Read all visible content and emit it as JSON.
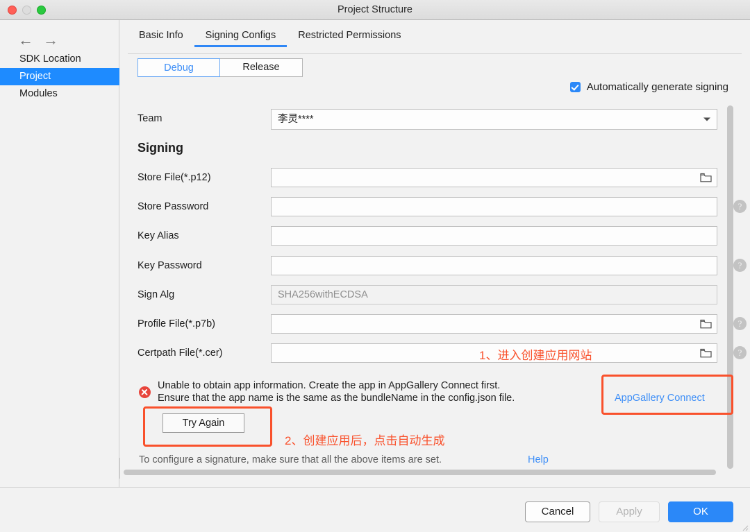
{
  "window": {
    "title": "Project Structure",
    "traffic_lights": [
      "close-button",
      "minimize-button",
      "maximize-button"
    ]
  },
  "sidebar": {
    "nav": {
      "back_icon": "arrow-left-icon",
      "forward_icon": "arrow-right-icon"
    },
    "items": [
      {
        "label": "SDK Location",
        "selected": false
      },
      {
        "label": "Project",
        "selected": true
      },
      {
        "label": "Modules",
        "selected": false
      }
    ]
  },
  "tabs": [
    {
      "label": "Basic Info",
      "active": false
    },
    {
      "label": "Signing Configs",
      "active": true
    },
    {
      "label": "Restricted Permissions",
      "active": false
    }
  ],
  "segmented": {
    "options": [
      {
        "label": "Debug",
        "active": true
      },
      {
        "label": "Release",
        "active": false
      }
    ]
  },
  "auto_signing": {
    "label": "Automatically generate signing",
    "checked": true
  },
  "team": {
    "label": "Team",
    "value": "李灵****"
  },
  "section_title": "Signing",
  "fields": [
    {
      "label": "Store File(*.p12)",
      "value": "",
      "placeholder": "",
      "has_folder": true,
      "has_help": false,
      "readonly": false
    },
    {
      "label": "Store Password",
      "value": "",
      "placeholder": "",
      "has_folder": false,
      "has_help": true,
      "readonly": false
    },
    {
      "label": "Key Alias",
      "value": "",
      "placeholder": "",
      "has_folder": false,
      "has_help": false,
      "readonly": false
    },
    {
      "label": "Key Password",
      "value": "",
      "placeholder": "",
      "has_folder": false,
      "has_help": true,
      "readonly": false
    },
    {
      "label": "Sign Alg",
      "value": "SHA256withECDSA",
      "placeholder": "",
      "has_folder": false,
      "has_help": false,
      "readonly": true
    },
    {
      "label": "Profile File(*.p7b)",
      "value": "",
      "placeholder": "",
      "has_folder": true,
      "has_help": true,
      "readonly": false
    },
    {
      "label": "Certpath File(*.cer)",
      "value": "",
      "placeholder": "",
      "has_folder": true,
      "has_help": true,
      "readonly": false
    }
  ],
  "error": {
    "line1": "Unable to obtain app information. Create the app in AppGallery Connect first.",
    "line2": "Ensure that the app name is the same as the bundleName in the config.json file.",
    "link_label": "AppGallery Connect",
    "retry_label": "Try Again"
  },
  "footer": {
    "note": "To configure a signature, make sure that all the above items are set.",
    "help_label": "Help"
  },
  "dialog_buttons": {
    "cancel": "Cancel",
    "apply": "Apply",
    "ok": "OK"
  },
  "annotations": [
    {
      "id": "step-1",
      "text": "1、进入创建应用网站"
    },
    {
      "id": "step-2",
      "text": "2、创建应用后，点击自动生成"
    }
  ],
  "colors": {
    "accent": "#2b88f8",
    "annotation_red": "#f9512c",
    "error_red": "#e8453c",
    "link_blue": "#3d8ef7",
    "selection_blue": "#1e8bff"
  }
}
